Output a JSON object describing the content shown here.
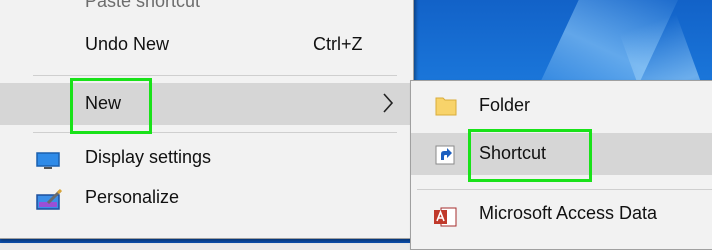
{
  "context_menu": {
    "items": [
      {
        "label": "Paste shortcut"
      },
      {
        "label": "Undo New",
        "shortcut": "Ctrl+Z"
      },
      {
        "label": "New",
        "submenu_arrow": "chevron-right-icon"
      },
      {
        "label": "Display settings",
        "icon": "display-icon"
      },
      {
        "label": "Personalize",
        "icon": "personalize-icon"
      }
    ]
  },
  "new_submenu": {
    "items": [
      {
        "label": "Folder",
        "icon": "folder-icon"
      },
      {
        "label": "Shortcut",
        "icon": "shortcut-icon"
      },
      {
        "label": "Microsoft Access Data",
        "icon": "access-icon"
      }
    ]
  },
  "highlight_color": "#19e219"
}
